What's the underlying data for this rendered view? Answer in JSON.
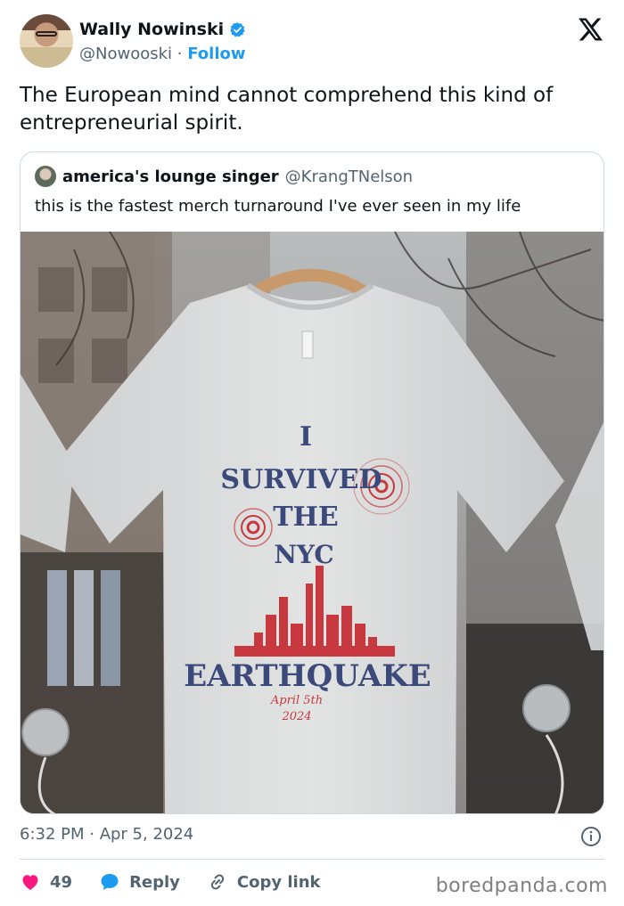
{
  "author": {
    "name": "Wally Nowinski",
    "handle": "@Nowooski",
    "separator": "·",
    "follow_label": "Follow"
  },
  "tweet": {
    "text": "The European mind cannot comprehend this kind of entrepreneurial spirit."
  },
  "quoted": {
    "name": "america's lounge singer",
    "handle": "@KrangTNelson",
    "text": "this is the fastest merch turnaround I've ever seen in my life"
  },
  "shirt": {
    "line1": "I",
    "line2": "SURVIVED",
    "line3": "THE",
    "line4": "NYC",
    "line5": "EARTHQUAKE",
    "line6": "April 5th",
    "line7": "2024"
  },
  "meta": {
    "timestamp": "6:32 PM · Apr 5, 2024"
  },
  "actions": {
    "like_count": "49",
    "reply_label": "Reply",
    "copy_label": "Copy link"
  },
  "watermark": "boredpanda.com",
  "colors": {
    "accent": "#1d9bf0",
    "like": "#f91880",
    "text": "#0f1419",
    "muted": "#536471",
    "border": "#cfd9de",
    "shirt_print_navy": "#3b4a7a",
    "shirt_print_red": "#c8393f"
  }
}
